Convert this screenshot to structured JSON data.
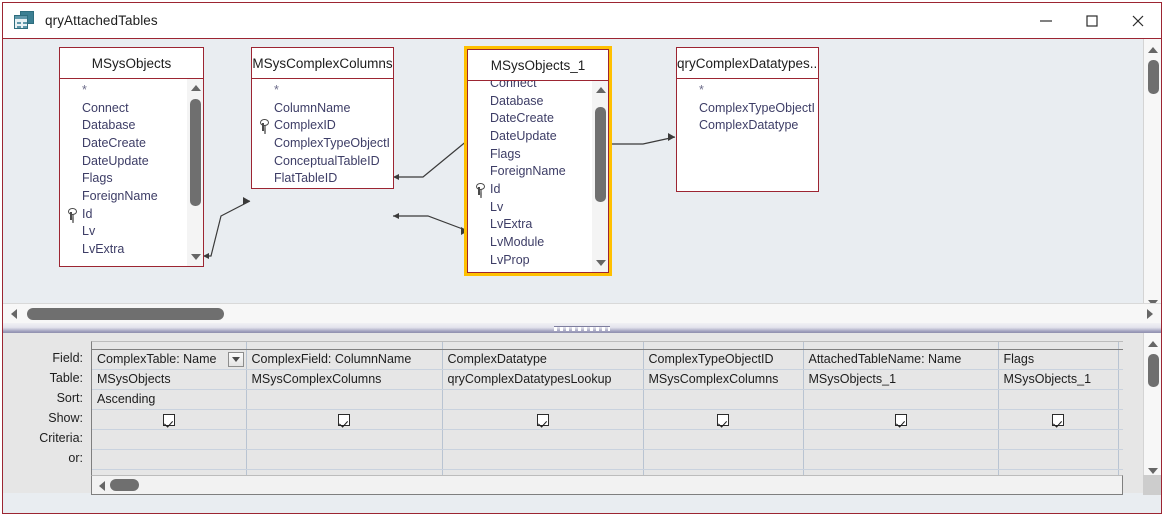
{
  "window": {
    "title": "qryAttachedTables",
    "icon": "query-datasheet-icon",
    "minimize_label": "Minimize",
    "maximize_label": "Maximize",
    "close_label": "Close",
    "accent_border": "#9c2532",
    "selection_color": "#ffc000",
    "pane_background": "#e9edf1",
    "grid_background": "#e6e6e6"
  },
  "diagram": {
    "tables": [
      {
        "name": "MSysObjects",
        "selected": false,
        "fields": [
          {
            "name": "*",
            "key": false
          },
          {
            "name": "Connect",
            "key": false
          },
          {
            "name": "Database",
            "key": false
          },
          {
            "name": "DateCreate",
            "key": false
          },
          {
            "name": "DateUpdate",
            "key": false
          },
          {
            "name": "Flags",
            "key": false
          },
          {
            "name": "ForeignName",
            "key": false
          },
          {
            "name": "Id",
            "key": true
          },
          {
            "name": "Lv",
            "key": false
          },
          {
            "name": "LvExtra",
            "key": false
          }
        ]
      },
      {
        "name": "MSysComplexColumns",
        "selected": false,
        "fields": [
          {
            "name": "*",
            "key": false
          },
          {
            "name": "ColumnName",
            "key": false
          },
          {
            "name": "ComplexID",
            "key": true
          },
          {
            "name": "ComplexTypeObjectI",
            "key": false
          },
          {
            "name": "ConceptualTableID",
            "key": false
          },
          {
            "name": "FlatTableID",
            "key": false
          }
        ]
      },
      {
        "name": "MSysObjects_1",
        "selected": true,
        "fields": [
          {
            "name": "Connect",
            "key": false
          },
          {
            "name": "Database",
            "key": false
          },
          {
            "name": "DateCreate",
            "key": false
          },
          {
            "name": "DateUpdate",
            "key": false
          },
          {
            "name": "Flags",
            "key": false
          },
          {
            "name": "ForeignName",
            "key": false
          },
          {
            "name": "Id",
            "key": true
          },
          {
            "name": "Lv",
            "key": false
          },
          {
            "name": "LvExtra",
            "key": false
          },
          {
            "name": "LvModule",
            "key": false
          },
          {
            "name": "LvProp",
            "key": false
          }
        ]
      },
      {
        "name": "qryComplexDatatypes...",
        "selected": false,
        "fields": [
          {
            "name": "*",
            "key": false
          },
          {
            "name": "ComplexTypeObjectI",
            "key": false
          },
          {
            "name": "ComplexDatatype",
            "key": false
          }
        ]
      }
    ]
  },
  "grid": {
    "row_labels": [
      "Field:",
      "Table:",
      "Sort:",
      "Show:",
      "Criteria:",
      "or:"
    ],
    "columns": [
      {
        "field": "ComplexTable: Name",
        "table": "MSysObjects",
        "sort": "Ascending",
        "show": true,
        "criteria": "",
        "or": "",
        "has_dropdown": true
      },
      {
        "field": "ComplexField: ColumnName",
        "table": "MSysComplexColumns",
        "sort": "",
        "show": true,
        "criteria": "",
        "or": "",
        "has_dropdown": false
      },
      {
        "field": "ComplexDatatype",
        "table": "qryComplexDatatypesLookup",
        "sort": "",
        "show": true,
        "criteria": "",
        "or": "",
        "has_dropdown": false
      },
      {
        "field": "ComplexTypeObjectID",
        "table": "MSysComplexColumns",
        "sort": "",
        "show": true,
        "criteria": "",
        "or": "",
        "has_dropdown": false
      },
      {
        "field": "AttachedTableName: Name",
        "table": "MSysObjects_1",
        "sort": "",
        "show": true,
        "criteria": "",
        "or": "",
        "has_dropdown": false
      },
      {
        "field": "Flags",
        "table": "MSysObjects_1",
        "sort": "",
        "show": true,
        "criteria": "",
        "or": "",
        "has_dropdown": false
      },
      {
        "field": "",
        "table": "",
        "sort": "",
        "show": false,
        "criteria": "",
        "or": "",
        "has_dropdown": false
      }
    ]
  }
}
